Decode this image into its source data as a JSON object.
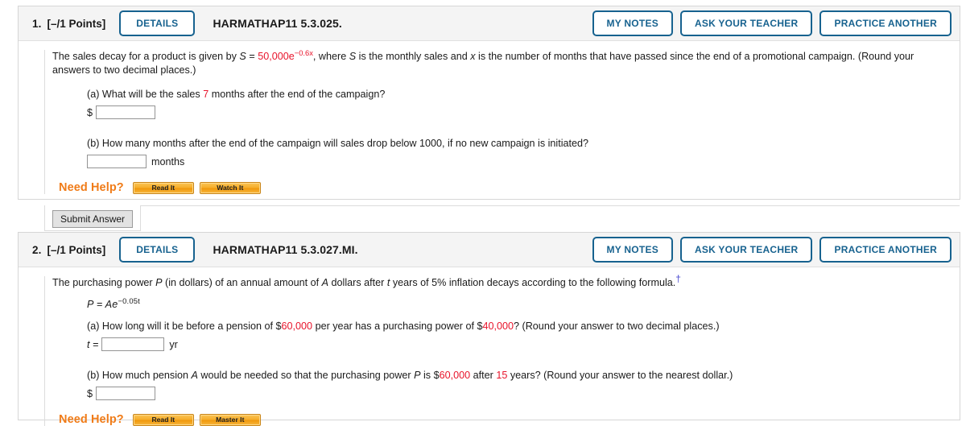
{
  "questions": [
    {
      "number": "1.",
      "points": "[–/1 Points]",
      "details_label": "DETAILS",
      "title": "HARMATHAP11 5.3.025.",
      "buttons": {
        "my_notes": "MY NOTES",
        "ask_teacher": "ASK YOUR TEACHER",
        "practice_another": "PRACTICE ANOTHER"
      },
      "prompt": {
        "lead": "The sales decay for a product is given by",
        "formula_var": "S",
        "formula_eq": "=",
        "formula_coeff": "50,000e",
        "formula_exp": "−0.6x",
        "after_formula": ",  where",
        "var_S": "S",
        "mid1": "is the monthly sales and",
        "var_x": "x",
        "tail": "is the number of months that have passed since the end of a promotional campaign. (Round your answers to two decimal places.)"
      },
      "parts": [
        {
          "label": "(a)",
          "text_before": "What will be the sales",
          "highlight": "7",
          "text_after": "months after the end of the campaign?",
          "answer_prefix": "$",
          "answer_value": "",
          "answer_unit": ""
        },
        {
          "label": "(b)",
          "text_before": "How many months after the end of the campaign will sales drop below 1000, if no new campaign is initiated?",
          "highlight": "",
          "text_after": "",
          "answer_prefix": "",
          "answer_value": "",
          "answer_unit": "months"
        }
      ],
      "need_help": {
        "label": "Need Help?",
        "buttons": [
          "Read It",
          "Watch It"
        ]
      },
      "submit_label": "Submit Answer",
      "has_submit": true
    },
    {
      "number": "2.",
      "points": "[–/1 Points]",
      "details_label": "DETAILS",
      "title": "HARMATHAP11 5.3.027.MI.",
      "buttons": {
        "my_notes": "MY NOTES",
        "ask_teacher": "ASK YOUR TEACHER",
        "practice_another": "PRACTICE ANOTHER"
      },
      "prompt": {
        "s1": "The purchasing power",
        "var_P": "P",
        "s2": "(in dollars) of an annual amount of",
        "var_A": "A",
        "s3": "dollars after",
        "var_t": "t",
        "s4": "years of 5% inflation decays according to the following formula.",
        "dagger": "†",
        "formula_lhs": "P",
        "formula_eq": "=",
        "formula_rhs": "Ae",
        "formula_exp": "−0.05t"
      },
      "parts": [
        {
          "label": "(a)",
          "seg1": "How long will it be before a pension of $",
          "hl1": "60,000",
          "seg2": "per year has a purchasing power of $",
          "hl2": "40,000",
          "seg3": "? (Round your answer to two decimal places.)",
          "answer_prefix": "t =",
          "answer_value": "",
          "answer_unit": "yr"
        },
        {
          "label": "(b)",
          "seg1": "How much pension",
          "varA": "A",
          "seg1b": "would be needed so that the purchasing power",
          "varP": "P",
          "seg2": "is $",
          "hl1": "60,000",
          "seg3": "after",
          "hl2": "15",
          "seg4": "years? (Round your answer to the nearest dollar.)",
          "answer_prefix": "$",
          "answer_value": "",
          "answer_unit": ""
        }
      ],
      "need_help": {
        "label": "Need Help?",
        "buttons": [
          "Read It",
          "Master It"
        ]
      },
      "submit_label": "",
      "has_submit": false
    }
  ],
  "colors": {
    "accent_blue": "#17628f",
    "highlight_red": "#e8142b",
    "help_orange": "#f07b17",
    "dagger_blue": "#4b4bd0"
  }
}
